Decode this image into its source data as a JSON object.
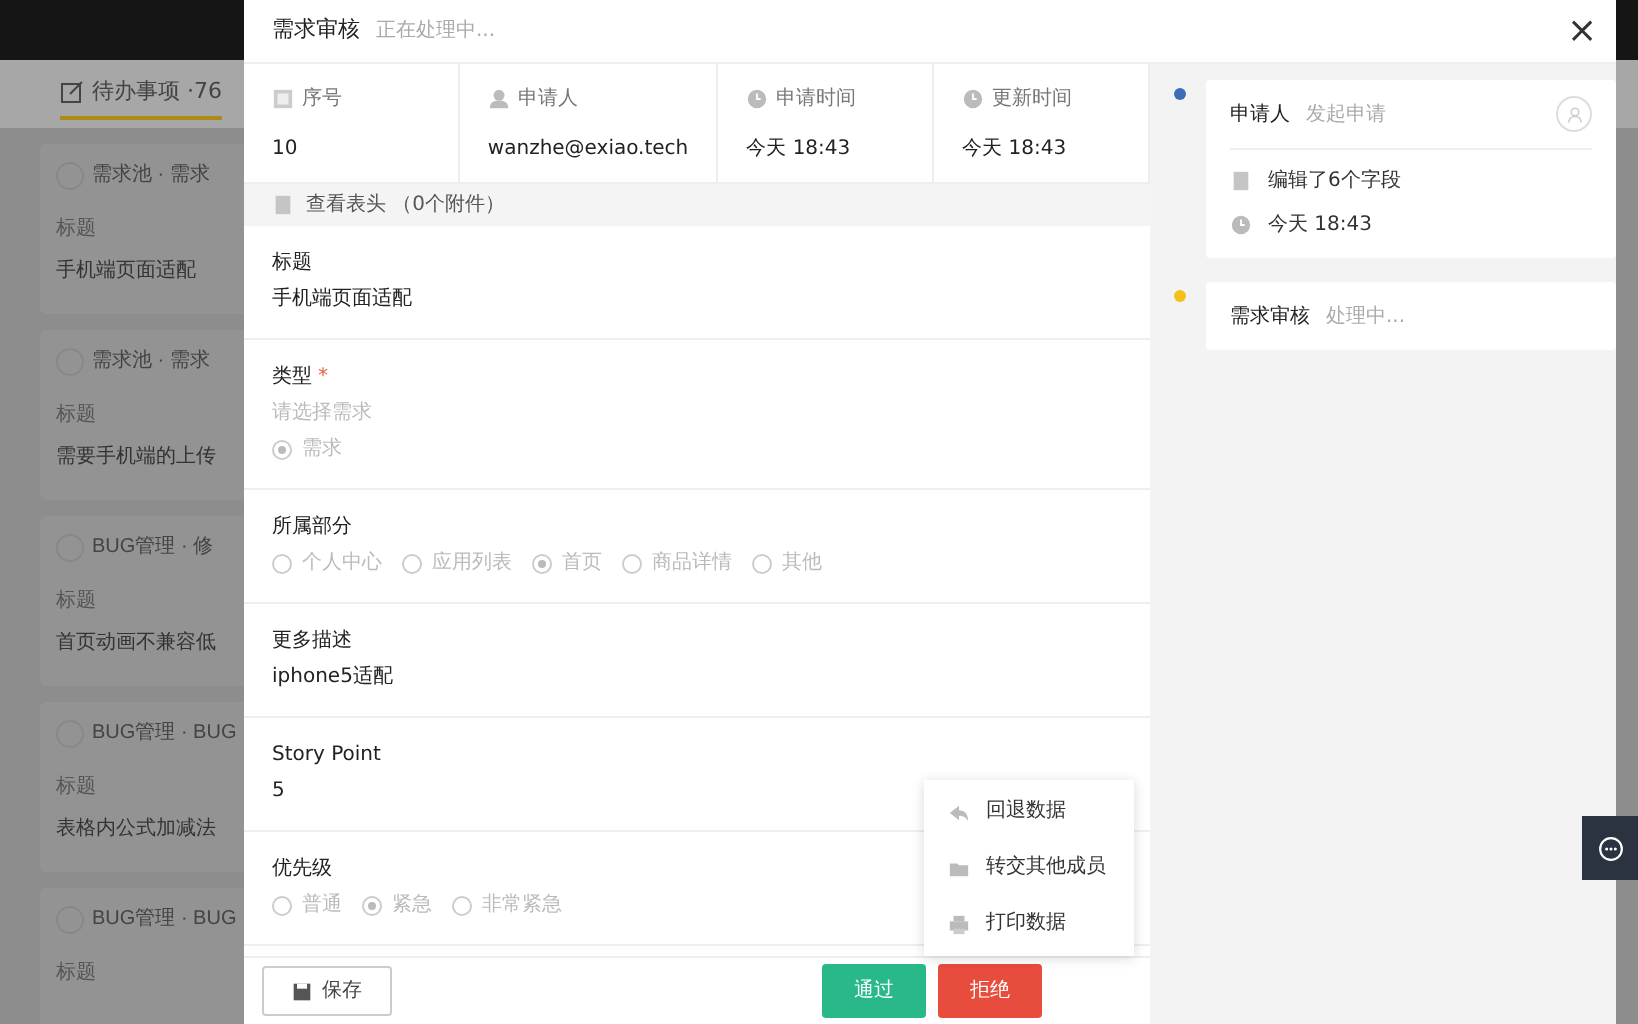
{
  "background": {
    "tab": {
      "label": "待办事项 ·76",
      "selected": true
    },
    "cards": [
      {
        "source": "需求池 · 需求",
        "field_label": "标题",
        "value": "手机端页面适配"
      },
      {
        "source": "需求池 · 需求",
        "field_label": "标题",
        "value": "需要手机端的上传"
      },
      {
        "source": "BUG管理 · 修",
        "field_label": "标题",
        "value": "首页动画不兼容低"
      },
      {
        "source": "BUG管理 · BUG",
        "field_label": "标题",
        "value": "表格内公式加减法"
      },
      {
        "source": "BUG管理 · BUG",
        "field_label": "标题"
      }
    ]
  },
  "dialog": {
    "title": "需求审核",
    "status": "正在处理中...",
    "close": "×",
    "info": [
      {
        "label": "序号",
        "value": "10"
      },
      {
        "label": "申请人",
        "value": "wanzhe@exiao.tech"
      },
      {
        "label": "申请时间",
        "value": "今天 18:43"
      },
      {
        "label": "更新时间",
        "value": "今天 18:43"
      }
    ],
    "attachments": "查看表头 （0个附件）",
    "fields": [
      {
        "kind": "text",
        "label": "标题",
        "required": false,
        "value": "手机端页面适配"
      },
      {
        "kind": "radio",
        "label": "类型",
        "required": true,
        "required_mark": "*",
        "hint": "请选择需求",
        "options": [
          {
            "label": "需求",
            "selected": true
          }
        ]
      },
      {
        "kind": "radio",
        "label": "所属部分",
        "required": false,
        "options": [
          {
            "label": "个人中心",
            "selected": false
          },
          {
            "label": "应用列表",
            "selected": false
          },
          {
            "label": "首页",
            "selected": true
          },
          {
            "label": "商品详情",
            "selected": false
          },
          {
            "label": "其他",
            "selected": false
          }
        ]
      },
      {
        "kind": "text",
        "label": "更多描述",
        "required": false,
        "value": "iphone5适配"
      },
      {
        "kind": "text",
        "label": "Story Point",
        "required": false,
        "value": "5"
      },
      {
        "kind": "radio",
        "label": "优先级",
        "required": false,
        "options": [
          {
            "label": "普通",
            "selected": false
          },
          {
            "label": "紧急",
            "selected": true
          },
          {
            "label": "非常紧急",
            "selected": false
          }
        ]
      }
    ],
    "menu": [
      {
        "label": "回退数据"
      },
      {
        "label": "转交其他成员"
      },
      {
        "label": "打印数据"
      }
    ],
    "buttons": [
      {
        "kind": "save",
        "label": "保存"
      },
      {
        "kind": "approve",
        "label": "通过"
      },
      {
        "kind": "reject",
        "label": "拒绝"
      }
    ],
    "timeline": [
      {
        "color": "#3d6db5",
        "title": "申请人",
        "status": "发起申请",
        "avatar": true,
        "details": [
          {
            "text": "编辑了6个字段"
          },
          {
            "text": "今天 18:43"
          }
        ]
      },
      {
        "color": "#f2c21b",
        "title": "需求审核",
        "status": "处理中...",
        "avatar": false
      }
    ]
  }
}
